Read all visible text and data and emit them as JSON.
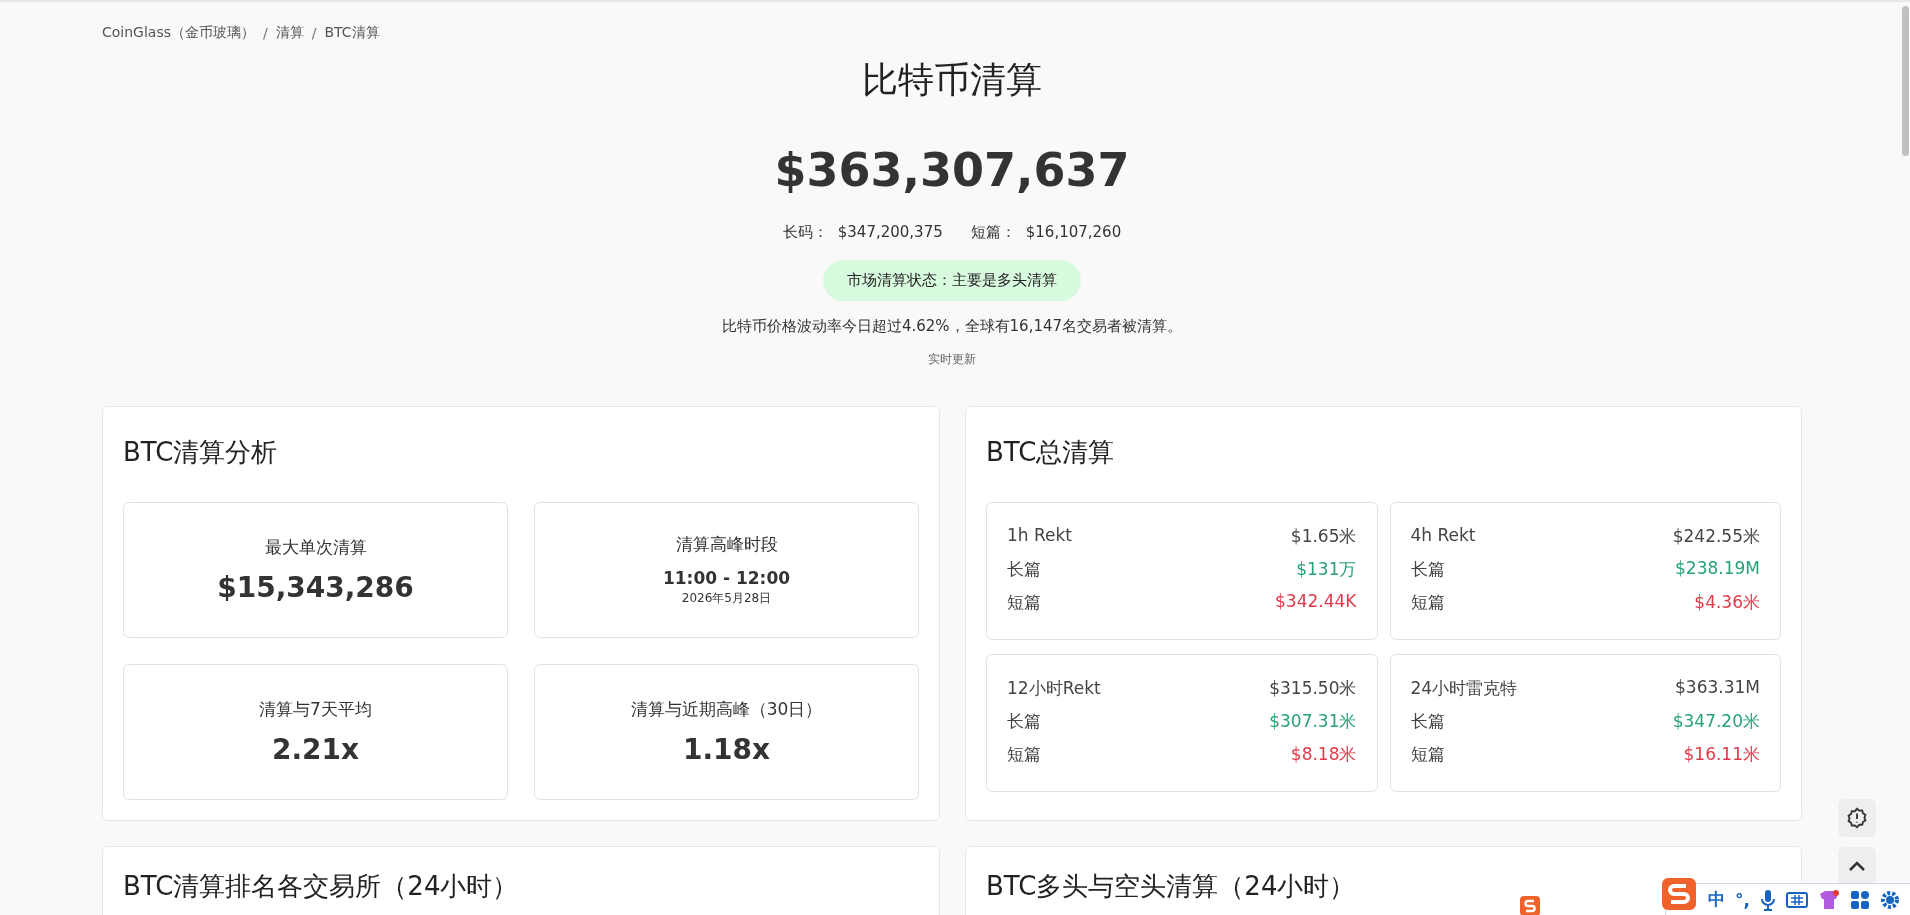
{
  "breadcrumb": [
    {
      "label": "CoinGlass（金币玻璃）"
    },
    {
      "separator": "/",
      "label": "清算"
    },
    {
      "separator": "/",
      "label": "BTC清算"
    }
  ],
  "title": "比特币清算",
  "total": "$363,307,637",
  "summary": [
    {
      "label": "长码：",
      "value": "$347,200,375"
    },
    {
      "label": "短篇：",
      "value": "$16,107,260"
    }
  ],
  "status_badge": "市场清算状态：主要是多头清算",
  "description": "比特币价格波动率今日超过4.62%，全球有16,147名交易者被清算。",
  "update_note": "实时更新",
  "panels": [
    {
      "title": "BTC清算分析",
      "kind": "stats",
      "stats": [
        {
          "label": "最大单次清算",
          "value": "$15,343,286"
        },
        {
          "label": "清算高峰时段",
          "value": "11:00 - 12:00",
          "sub": "2026年5月28日"
        },
        {
          "label": "清算与7天平均",
          "value": "2.21x"
        },
        {
          "label": "清算与近期高峰（30日）",
          "value": "1.18x"
        }
      ]
    },
    {
      "title": "BTC总清算",
      "kind": "rekt",
      "blocks": [
        {
          "label": "1h Rekt",
          "total": "$1.65米",
          "rows": [
            {
              "label": "长篇",
              "value": "$131万",
              "kind": "long"
            },
            {
              "label": "短篇",
              "value": "$342.44K",
              "kind": "short"
            }
          ]
        },
        {
          "label": "4h Rekt",
          "total": "$242.55米",
          "rows": [
            {
              "label": "长篇",
              "value": "$238.19M",
              "kind": "long"
            },
            {
              "label": "短篇",
              "value": "$4.36米",
              "kind": "short"
            }
          ]
        },
        {
          "label": "12小时Rekt",
          "total": "$315.50米",
          "rows": [
            {
              "label": "长篇",
              "value": "$307.31米",
              "kind": "long"
            },
            {
              "label": "短篇",
              "value": "$8.18米",
              "kind": "short"
            }
          ]
        },
        {
          "label": "24小时雷克特",
          "total": "$363.31M",
          "rows": [
            {
              "label": "长篇",
              "value": "$347.20米",
              "kind": "long"
            },
            {
              "label": "短篇",
              "value": "$16.11米",
              "kind": "short"
            }
          ]
        }
      ]
    }
  ],
  "lower_panels": [
    {
      "title": "BTC清算排名各交易所（24小时）"
    },
    {
      "title": "BTC多头与空头清算（24小时）"
    }
  ],
  "ime_toolbar": {
    "mode": "中",
    "punctuation": "°,"
  }
}
